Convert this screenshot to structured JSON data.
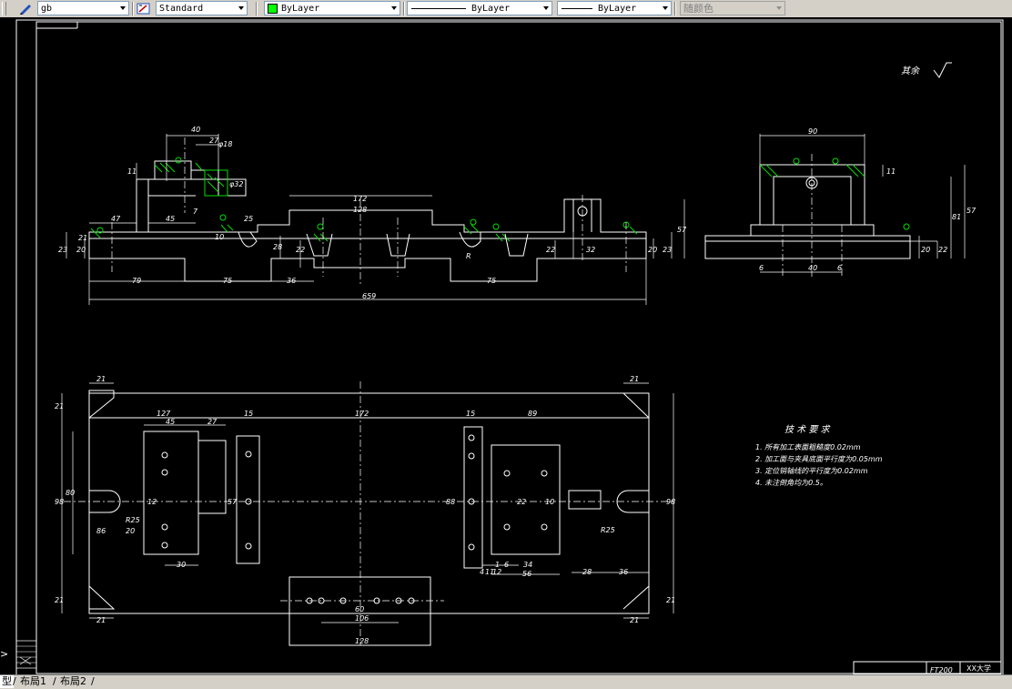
{
  "toolbar": {
    "textstyle_value": "gb",
    "dimstyle_value": "Standard",
    "layer_color": "#00ff00",
    "layer_value": "ByLayer",
    "linetype_value": "ByLayer",
    "lineweight_value": "ByLayer",
    "plotstyle_value": "随颜色"
  },
  "drawing": {
    "roughness": "其余",
    "tech_title": "技 术 要 求",
    "tech_notes": [
      "1. 所有加工表面粗糙度0.02mm",
      "2. 加工面与夹具底面平行度为0.05mm",
      "3. 定位销轴线的平行度为0.02mm",
      "4. 未注倒角均为0.5。"
    ],
    "title_block_code": "FT200",
    "title_block_school": "XX大学",
    "dims_front": [
      "40",
      "27",
      "φ18",
      "11",
      "φ32",
      "172",
      "128",
      "47",
      "45",
      "7",
      "25",
      "10",
      "28",
      "22",
      "20",
      "23",
      "21",
      "R",
      "79",
      "75",
      "36",
      "659",
      "75",
      "22",
      "32",
      "20",
      "23",
      "57"
    ],
    "dims_side": [
      "90",
      "11",
      "81",
      "57",
      "20",
      "22",
      "6",
      "40",
      "6"
    ],
    "dims_plan": [
      "21",
      "21",
      "127",
      "45",
      "27",
      "15",
      "172",
      "15",
      "89",
      "21",
      "98",
      "98",
      "80",
      "57",
      "12",
      "22",
      "10",
      "88",
      "R25",
      "R25",
      "86",
      "20",
      "30",
      "4",
      "1",
      "6",
      "11",
      "12",
      "34",
      "56",
      "28",
      "36",
      "21",
      "21",
      "21",
      "21",
      "60",
      "106",
      "128"
    ]
  },
  "tabs": {
    "model": "型",
    "layout1": "布局1",
    "layout2": "布局2"
  }
}
